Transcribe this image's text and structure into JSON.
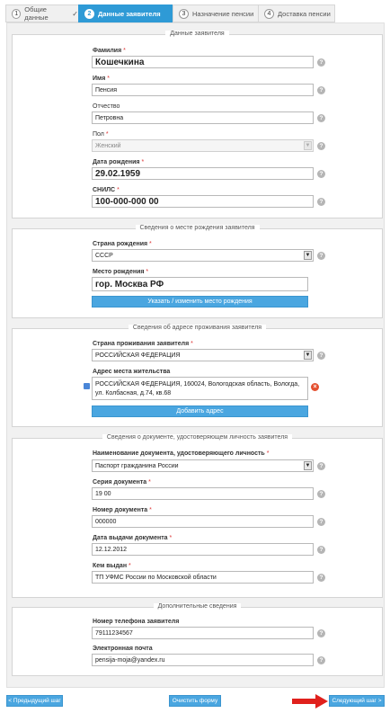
{
  "tabs": [
    {
      "num": "1",
      "label": "Общие данные",
      "check": "✓"
    },
    {
      "num": "2",
      "label": "Данные заявителя"
    },
    {
      "num": "3",
      "label": "Назначение пенсии"
    },
    {
      "num": "4",
      "label": "Доставка пенсии"
    }
  ],
  "sections": {
    "applicant": {
      "title": "Данные заявителя",
      "surname": {
        "label": "Фамилия",
        "value": "Кошечкина"
      },
      "name": {
        "label": "Имя",
        "value": "Пенсия"
      },
      "patronymic": {
        "label": "Отчество",
        "value": "Петровна"
      },
      "gender": {
        "label": "Пол",
        "value": "Женский"
      },
      "birthdate": {
        "label": "Дата рождения",
        "value": "29.02.1959"
      },
      "snils": {
        "label": "СНИЛС",
        "value": "100-000-000 00"
      }
    },
    "birthplace": {
      "title": "Сведения о месте рождения заявителя",
      "country": {
        "label": "Страна рождения",
        "value": "СССР"
      },
      "place": {
        "label": "Место рождения",
        "value": "гор. Москва РФ"
      },
      "button": "Указать / изменить место рождения"
    },
    "residence": {
      "title": "Сведения об адресе проживания заявителя",
      "country": {
        "label": "Страна проживания заявителя",
        "value": "РОССИЙСКАЯ ФЕДЕРАЦИЯ"
      },
      "address_label": "Адрес места жительства",
      "address_line1": "РОССИЙСКАЯ ФЕДЕРАЦИЯ, 160024, Вологодская область, Вологда,",
      "address_line2": "ул. Колбасная, д.74, кв.68",
      "button": "Добавить адрес"
    },
    "document": {
      "title": "Сведения о документе, удостоверяющем личность заявителя",
      "doc_name": {
        "label": "Наименование документа, удостоверяющего личность",
        "value": "Паспорт гражданина России"
      },
      "series": {
        "label": "Серия документа",
        "value": "19 00"
      },
      "number": {
        "label": "Номер документа",
        "value": "000000"
      },
      "issue_date": {
        "label": "Дата выдачи документа",
        "value": "12.12.2012"
      },
      "issued_by": {
        "label": "Кем выдан",
        "value": "ТП УФМС России по Московской области"
      }
    },
    "extra": {
      "title": "Дополнительные сведения",
      "phone": {
        "label": "Номер телефона заявителя",
        "value": "79111234567"
      },
      "email": {
        "label": "Электронная почта",
        "value": "pensija-moja@yandex.ru"
      }
    }
  },
  "required_mark": "*",
  "help_glyph": "?",
  "footer": {
    "prev": "< Предыдущий шаг",
    "clear": "Очистить форму",
    "next": "Следующий шаг >"
  },
  "colors": {
    "accent": "#2e9ad6",
    "button": "#4aa6e0",
    "arrow": "#e0201c"
  }
}
